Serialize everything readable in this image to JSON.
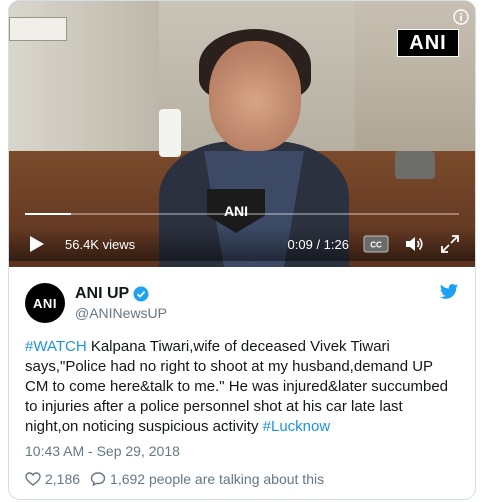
{
  "video": {
    "views": "56.4K views",
    "time": "0:09 / 1:26",
    "progress": 0.105,
    "channel_badge": "ANI",
    "mic_badge": "ANI",
    "cc_label": "CC",
    "icons": [
      "info-icon",
      "play-icon",
      "cc-icon",
      "volume-icon",
      "expand-icon"
    ]
  },
  "tweet": {
    "avatar_text": "ANI",
    "display_name": "ANI UP",
    "handle": "@ANINewsUP",
    "text_parts": {
      "hashtag1": "#WATCH",
      "body": " Kalpana Tiwari,wife of deceased Vivek Tiwari says,\"Police had no right to shoot at my husband,demand UP CM to come here&talk to me.\" He was injured&later succumbed to injuries after a police personnel shot at his car late last night,on noticing suspicious activity ",
      "hashtag2": "#Lucknow"
    },
    "timestamp": "10:43 AM - Sep 29, 2018",
    "likes": "2,186",
    "talking": "1,692 people are talking about this"
  },
  "colors": {
    "link": "#1b95e0",
    "meta": "#657786",
    "border": "#d6dde3",
    "verified": "#1da1f2"
  }
}
